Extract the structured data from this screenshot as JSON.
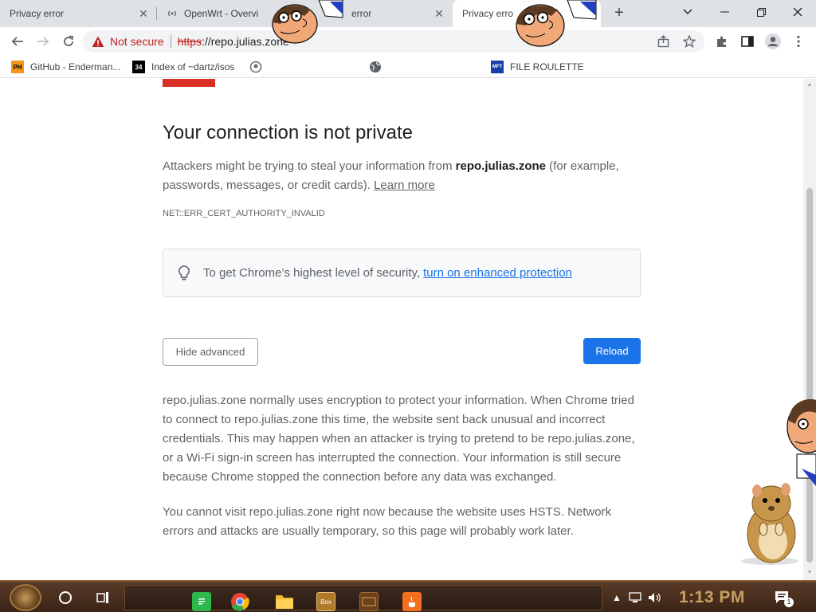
{
  "tabs": [
    {
      "title": "Privacy error",
      "active": false,
      "favicon": "warning-icon"
    },
    {
      "title": "OpenWrt - Overvi",
      "active": false,
      "favicon": "antenna-icon"
    },
    {
      "title": "error",
      "active": false,
      "favicon": "warning-icon"
    },
    {
      "title": "Privacy erro",
      "active": true,
      "favicon": "warning-icon"
    }
  ],
  "toolbar": {
    "not_secure": "Not secure",
    "url_scheme": "https",
    "url_rest": "://repo.julias.zone"
  },
  "bookmarks": [
    {
      "label": "GitHub - Enderman...",
      "icon": "ph-icon",
      "color": "#f7971d",
      "icon_text": "PH"
    },
    {
      "label": "Index of ~dartz/isos",
      "icon": "grid-icon",
      "color": "#000000",
      "icon_text": "34"
    },
    {
      "label": "",
      "icon": "badge-icon",
      "color": "#6b6b6b",
      "icon_text": ""
    },
    {
      "label": "",
      "icon": "globe-icon",
      "color": "#5f6368",
      "icon_text": ""
    },
    {
      "label": "FILE ROULETTE",
      "icon": "mft-icon",
      "color": "#1a3fa8",
      "icon_text": "MFT"
    }
  ],
  "error": {
    "title": "Your connection is not private",
    "desc_pre": "Attackers might be trying to steal your information from ",
    "desc_host": "repo.julias.zone",
    "desc_post": " (for example, passwords, messages, or credit cards). ",
    "learn_more": "Learn more",
    "code": "NET::ERR_CERT_AUTHORITY_INVALID",
    "enhanced_text": "To get Chrome’s highest level of security,",
    "enhanced_link": "turn on enhanced protection",
    "hide_advanced": "Hide advanced",
    "reload": "Reload",
    "advanced_p1": "repo.julias.zone normally uses encryption to protect your information. When Chrome tried to connect to repo.julias.zone this time, the website sent back unusual and incorrect credentials. This may happen when an attacker is trying to pretend to be repo.julias.zone, or a Wi-Fi sign-in screen has interrupted the connection. Your information is still secure because Chrome stopped the connection before any data was exchanged.",
    "advanced_p2": "You cannot visit repo.julias.zone right now because the website uses HSTS. Network errors and attacks are usually temporary, so this page will probably work later."
  },
  "taskbar": {
    "clock": "1:13 PM",
    "notification_count": "1",
    "apps": [
      {
        "name": "notes-app-icon",
        "color": "#2db84b",
        "label": ""
      },
      {
        "name": "chrome-icon",
        "color": "#ea4335",
        "label": ""
      },
      {
        "name": "folder-icon",
        "color": "#f2b632",
        "label": ""
      },
      {
        "name": "game-icon",
        "color": "#b07a2a",
        "label": "Box"
      },
      {
        "name": "dvd-icon",
        "color": "#6a4020",
        "label": ""
      },
      {
        "name": "java-icon",
        "color": "#f07020",
        "label": ""
      }
    ]
  },
  "colors": {
    "accent": "#1a73e8",
    "danger": "#d93025"
  }
}
